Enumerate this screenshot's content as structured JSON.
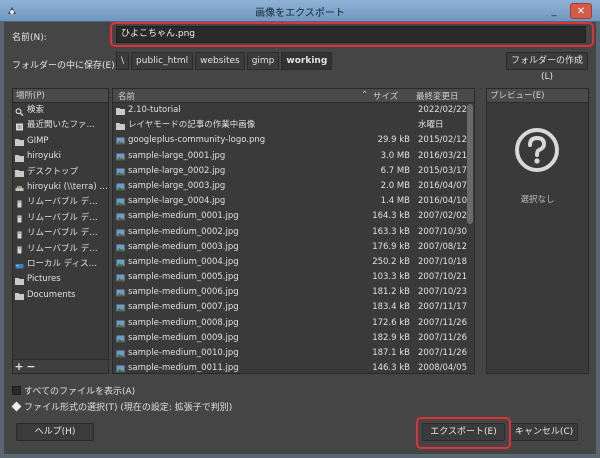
{
  "window": {
    "title": "画像をエクスポート"
  },
  "name_field": {
    "label": "名前(N):",
    "value": "ひよこちゃん.png"
  },
  "folder": {
    "label": "フォルダーの中に保存(E):",
    "path": [
      "\\",
      "public_html",
      "websites",
      "gimp",
      "working"
    ],
    "create_folder_label": "フォルダーの作成(L)"
  },
  "places": {
    "header": "場所(P)",
    "items": [
      {
        "label": "検索",
        "icon": "search-icon"
      },
      {
        "label": "最近開いたファ…",
        "icon": "recent-icon"
      },
      {
        "label": "GIMP",
        "icon": "folder-icon"
      },
      {
        "label": "hiroyuki",
        "icon": "folder-icon"
      },
      {
        "label": "デスクトップ",
        "icon": "folder-icon"
      },
      {
        "label": "hiroyuki (\\\\terra) …",
        "icon": "network-drive-icon"
      },
      {
        "label": "リムーバブル デ…",
        "icon": "removable-drive-icon"
      },
      {
        "label": "リムーバブル デ…",
        "icon": "removable-drive-icon"
      },
      {
        "label": "リムーバブル デ…",
        "icon": "removable-drive-icon"
      },
      {
        "label": "リムーバブル デ…",
        "icon": "removable-drive-icon"
      },
      {
        "label": "ローカル ディス…",
        "icon": "local-disk-icon"
      },
      {
        "label": "Pictures",
        "icon": "folder-icon"
      },
      {
        "label": "Documents",
        "icon": "folder-icon"
      }
    ],
    "add_label": "+",
    "remove_label": "−"
  },
  "files": {
    "columns": {
      "name": "名前",
      "size": "サイズ",
      "modified": "最終変更日"
    },
    "rows": [
      {
        "name": "2.10-tutorial",
        "size": "",
        "date": "2022/02/22",
        "type": "folder"
      },
      {
        "name": "レイヤモードの記事の作業中画像",
        "size": "",
        "date": "水曜日",
        "type": "folder"
      },
      {
        "name": "googleplus-community-logo.png",
        "size": "29.9 kB",
        "date": "2015/02/12",
        "type": "image"
      },
      {
        "name": "sample-large_0001.jpg",
        "size": "3.0 MB",
        "date": "2016/03/21",
        "type": "image"
      },
      {
        "name": "sample-large_0002.jpg",
        "size": "6.7 MB",
        "date": "2015/03/17",
        "type": "image"
      },
      {
        "name": "sample-large_0003.jpg",
        "size": "2.0 MB",
        "date": "2016/04/07",
        "type": "image"
      },
      {
        "name": "sample-large_0004.jpg",
        "size": "1.4 MB",
        "date": "2016/04/10",
        "type": "image"
      },
      {
        "name": "sample-medium_0001.jpg",
        "size": "164.3 kB",
        "date": "2007/02/02",
        "type": "image"
      },
      {
        "name": "sample-medium_0002.jpg",
        "size": "163.3 kB",
        "date": "2007/10/30",
        "type": "image"
      },
      {
        "name": "sample-medium_0003.jpg",
        "size": "176.9 kB",
        "date": "2007/08/12",
        "type": "image"
      },
      {
        "name": "sample-medium_0004.jpg",
        "size": "250.2 kB",
        "date": "2007/10/18",
        "type": "image"
      },
      {
        "name": "sample-medium_0005.jpg",
        "size": "103.3 kB",
        "date": "2007/10/21",
        "type": "image"
      },
      {
        "name": "sample-medium_0006.jpg",
        "size": "181.2 kB",
        "date": "2007/10/23",
        "type": "image"
      },
      {
        "name": "sample-medium_0007.jpg",
        "size": "183.4 kB",
        "date": "2007/11/17",
        "type": "image"
      },
      {
        "name": "sample-medium_0008.jpg",
        "size": "172.6 kB",
        "date": "2007/11/26",
        "type": "image"
      },
      {
        "name": "sample-medium_0009.jpg",
        "size": "182.9 kB",
        "date": "2007/11/26",
        "type": "image"
      },
      {
        "name": "sample-medium_0010.jpg",
        "size": "187.1 kB",
        "date": "2007/11/26",
        "type": "image"
      },
      {
        "name": "sample-medium_0011.jpg",
        "size": "146.3 kB",
        "date": "2008/04/05",
        "type": "image"
      }
    ]
  },
  "preview": {
    "header": "プレビュー(E)",
    "no_selection": "選択なし"
  },
  "options": {
    "show_all": "すべてのファイルを表示(A)",
    "file_type": "ファイル形式の選択(T) (現在の設定: 拡張子で判別)"
  },
  "buttons": {
    "help": "ヘルプ(H)",
    "export": "エクスポート(E)",
    "cancel": "キャンセル(C)"
  },
  "colors": {
    "highlight": "#e0303c",
    "folder": "#c9c9c9",
    "image_thumb": "#6f9bc4"
  }
}
